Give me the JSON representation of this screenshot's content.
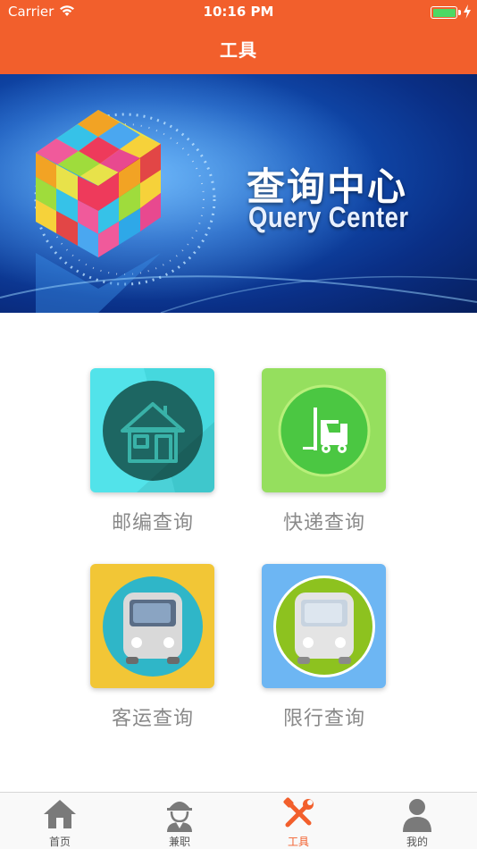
{
  "status_bar": {
    "carrier": "Carrier",
    "time": "10:16 PM"
  },
  "nav": {
    "title": "工具"
  },
  "banner": {
    "title_cn": "查询中心",
    "title_en": "Query Center"
  },
  "tools": [
    {
      "label": "邮编查询",
      "icon": "house-icon",
      "bg": "#52e3ea",
      "circle": "#1d6662"
    },
    {
      "label": "快递查询",
      "icon": "forklift-icon",
      "bg": "#95df5e",
      "circle": "#4bc742"
    },
    {
      "label": "客运查询",
      "icon": "bus-icon",
      "bg": "#f2c636",
      "circle": "#2fb6c8"
    },
    {
      "label": "限行查询",
      "icon": "bus-icon",
      "bg": "#6db6f3",
      "circle": "#8dc21f"
    }
  ],
  "tabbar": {
    "active_color": "#f25f2c",
    "items": [
      {
        "label": "首页",
        "icon": "home-icon"
      },
      {
        "label": "兼职",
        "icon": "worker-icon"
      },
      {
        "label": "工具",
        "icon": "tools-icon",
        "active": true
      },
      {
        "label": "我的",
        "icon": "person-icon"
      }
    ]
  }
}
